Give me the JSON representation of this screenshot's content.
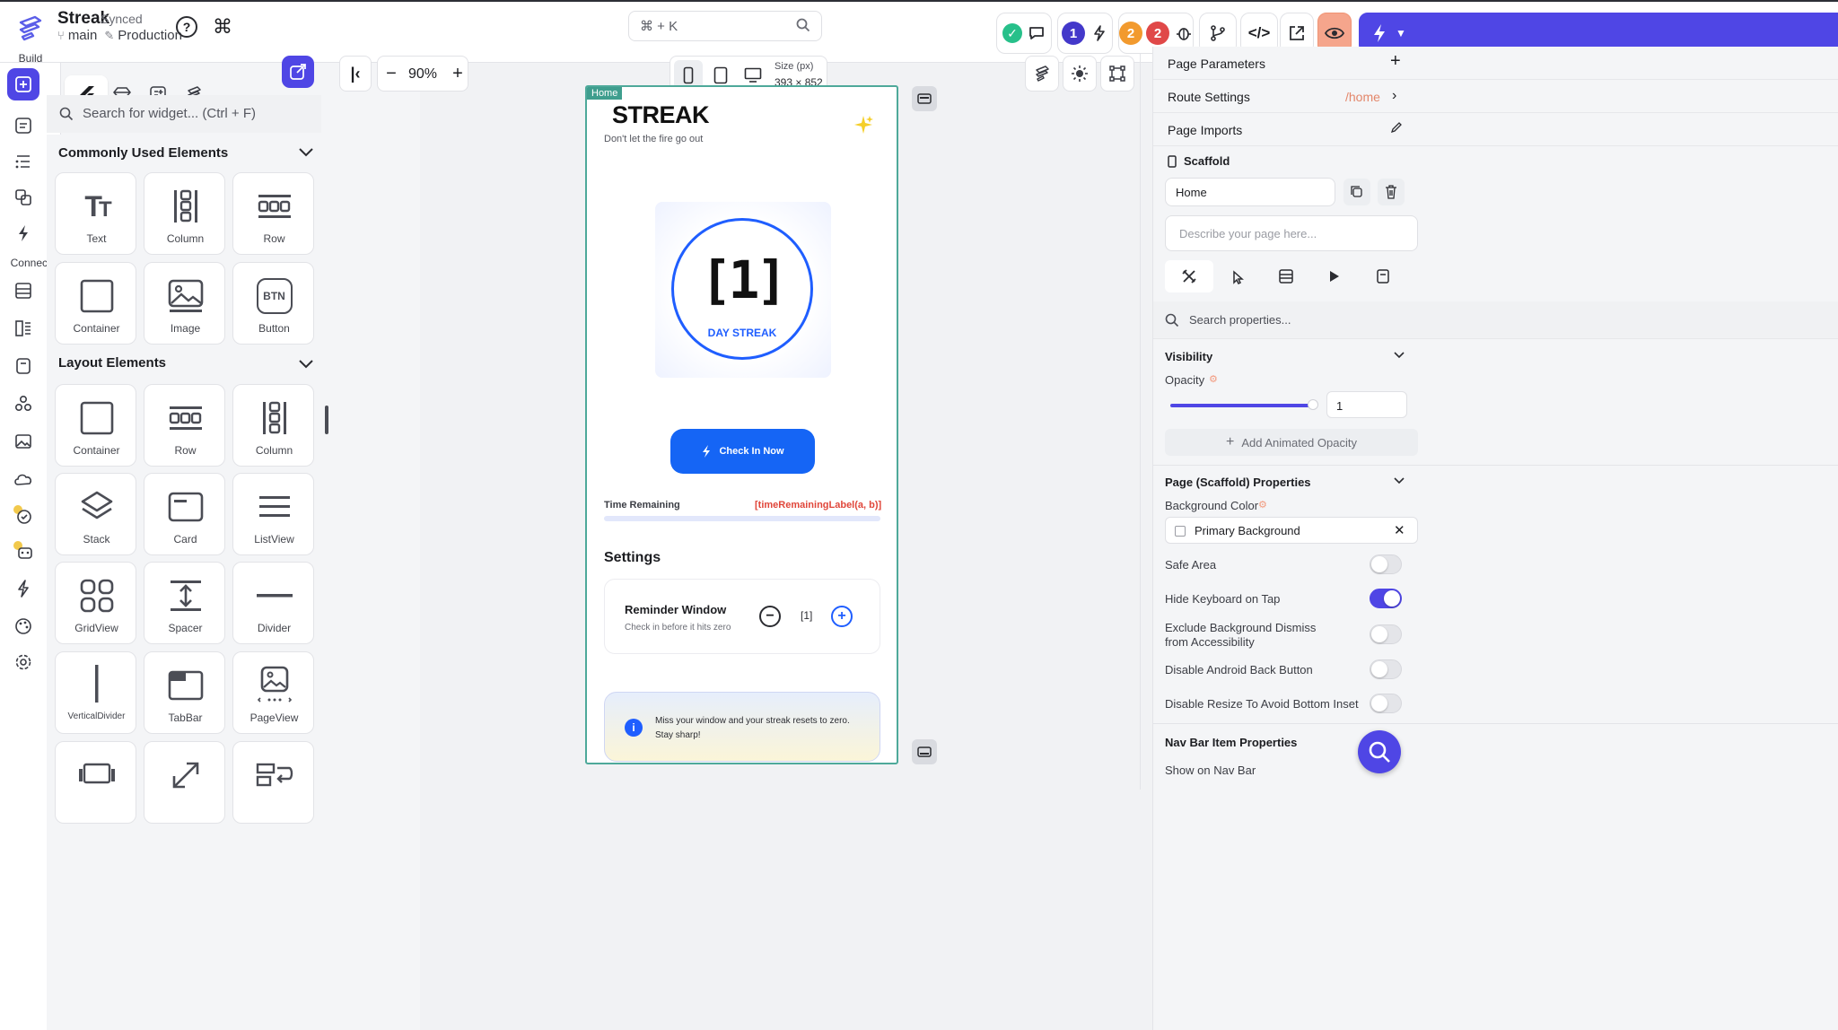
{
  "app": {
    "project_name": "Streak",
    "sync_status": "Synced",
    "branch": "main",
    "environment": "Production",
    "search_shortcut": "⌘ + K",
    "badges": {
      "blue": "1",
      "orange": "2",
      "red": "2"
    }
  },
  "rail": {
    "build_label": "Build",
    "connect_label": "Connect"
  },
  "widgets": {
    "search_placeholder": "Search for widget... (Ctrl + F)",
    "common_title": "Commonly Used Elements",
    "common": [
      "Text",
      "Column",
      "Row",
      "Container",
      "Image",
      "Button"
    ],
    "layout_title": "Layout Elements",
    "layout": [
      "Container",
      "Row",
      "Column",
      "Stack",
      "Card",
      "ListView",
      "GridView",
      "Spacer",
      "Divider",
      "VerticalDivider",
      "TabBar",
      "PageView"
    ],
    "button_glyph": "BTN"
  },
  "canvas": {
    "zoom": "90%",
    "size_label": "Size (px)",
    "size_value": "393 × 852",
    "page_tag": "Home"
  },
  "phone": {
    "title": "STREAK",
    "subtitle": "Don't let the fire go out",
    "streak_value": "[1]",
    "streak_label": "DAY STREAK",
    "checkin_button": "Check In Now",
    "time_remaining_label": "Time Remaining",
    "time_remaining_value": "[timeRemainingLabel(a, b)]",
    "settings_title": "Settings",
    "reminder_title": "Reminder Window",
    "reminder_sub": "Check in before it hits zero",
    "reminder_value": "[1]",
    "info_text": "Miss your window and your streak resets to zero. Stay sharp!"
  },
  "props": {
    "page_parameters": "Page Parameters",
    "route_settings": "Route Settings",
    "route_value": "/home",
    "page_imports": "Page Imports",
    "scaffold": "Scaffold",
    "page_name": "Home",
    "describe_placeholder": "Describe your page here...",
    "search_placeholder": "Search properties...",
    "visibility": "Visibility",
    "opacity": "Opacity",
    "opacity_value": "1",
    "add_animated_opacity": "Add Animated Opacity",
    "scaffold_props": "Page (Scaffold) Properties",
    "background_color": "Background Color",
    "primary_background": "Primary Background",
    "safe_area": "Safe Area",
    "hide_keyboard": "Hide Keyboard on Tap",
    "exclude_bg_1": "Exclude Background Dismiss",
    "exclude_bg_2": "from Accessibility",
    "disable_back": "Disable Android Back Button",
    "disable_resize": "Disable Resize To Avoid Bottom Inset",
    "nav_bar_props": "Nav Bar Item Properties",
    "show_on_nav": "Show on Nav Bar"
  },
  "colors": {
    "accent": "#4f46e5",
    "phone_blue": "#1f5eff",
    "timer_red": "#e0463a",
    "page_border": "#4ea99a"
  }
}
